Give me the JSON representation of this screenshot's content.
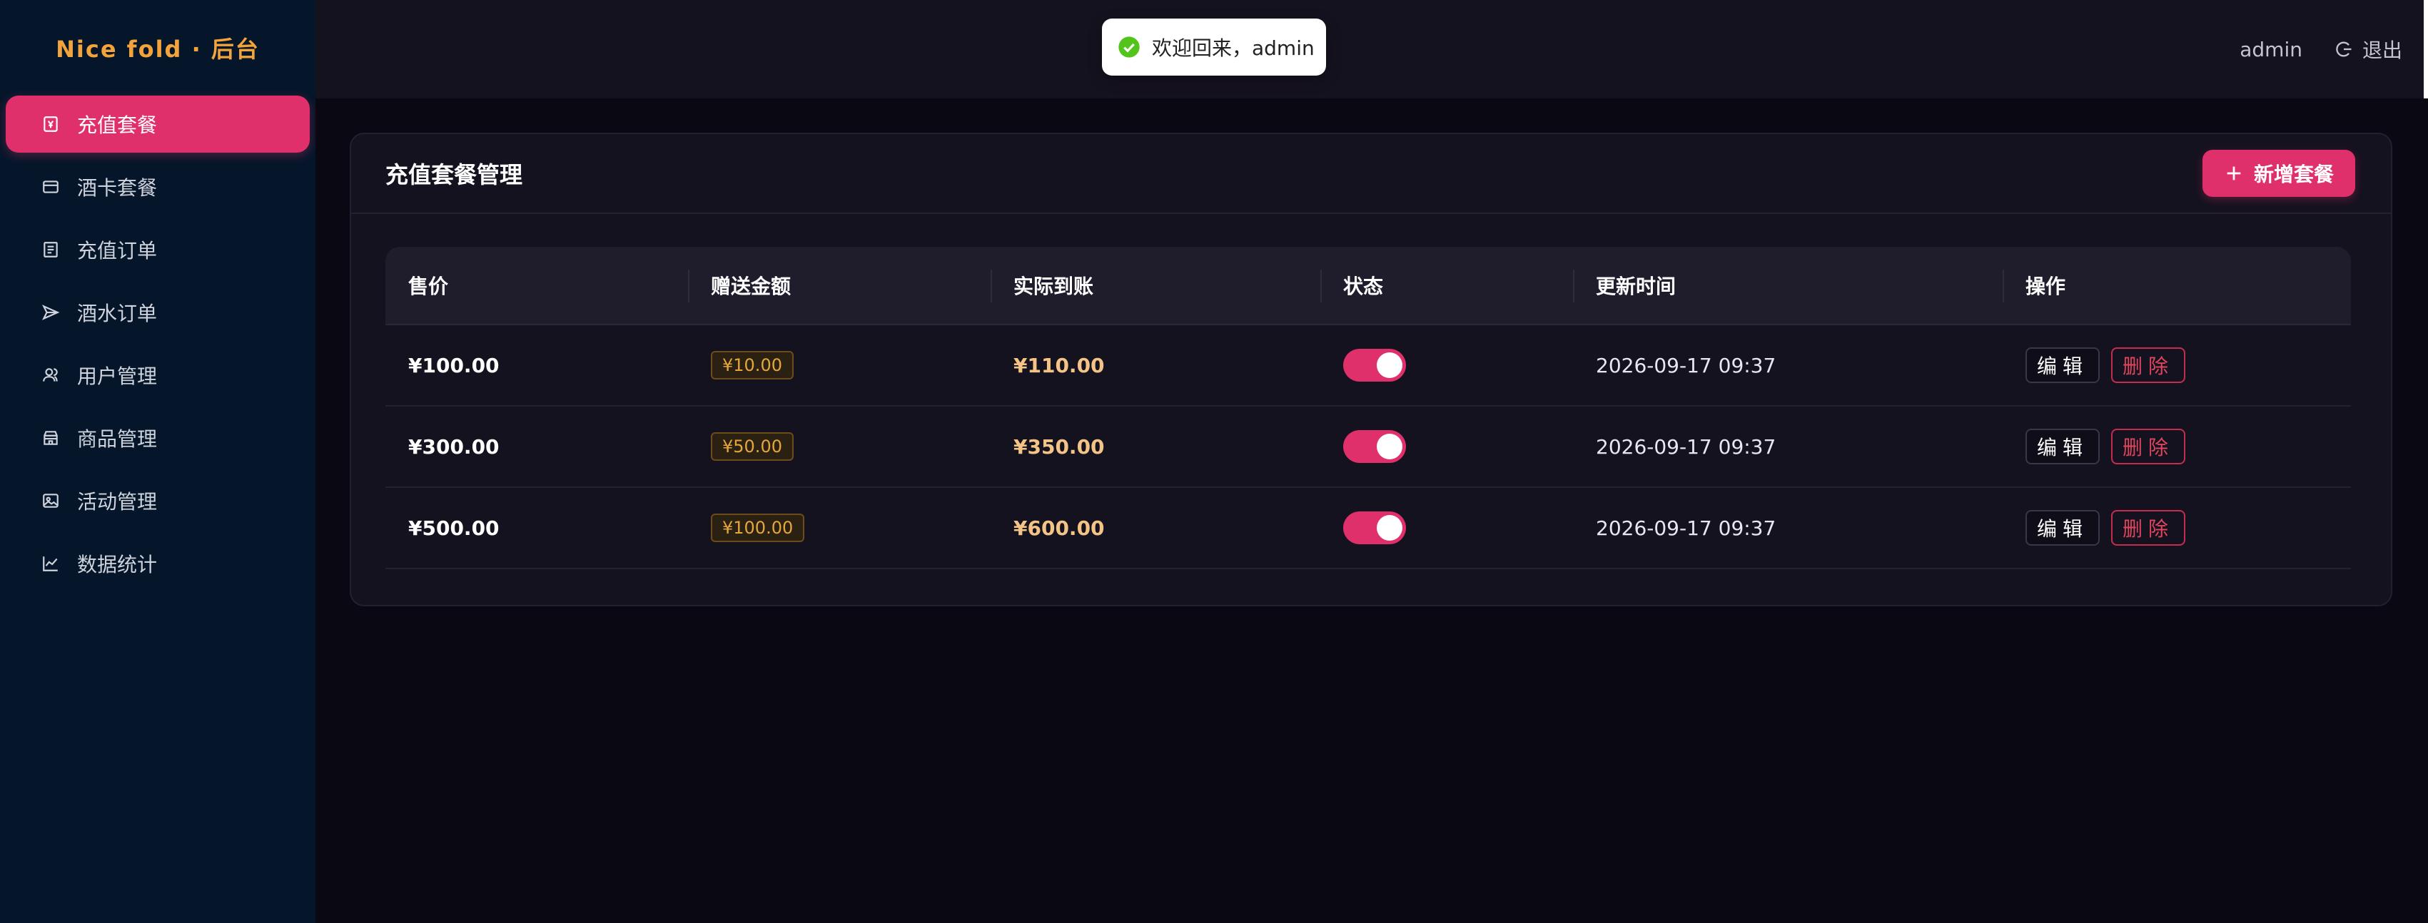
{
  "brand": {
    "title": "Nice fold · 后台"
  },
  "sidebar": {
    "items": [
      {
        "label": "充值套餐",
        "icon": "recharge-icon",
        "active": true
      },
      {
        "label": "酒卡套餐",
        "icon": "card-icon",
        "active": false
      },
      {
        "label": "充值订单",
        "icon": "order-list-icon",
        "active": false
      },
      {
        "label": "酒水订单",
        "icon": "send-icon",
        "active": false
      },
      {
        "label": "用户管理",
        "icon": "users-icon",
        "active": false
      },
      {
        "label": "商品管理",
        "icon": "store-icon",
        "active": false
      },
      {
        "label": "活动管理",
        "icon": "image-icon",
        "active": false
      },
      {
        "label": "数据统计",
        "icon": "chart-icon",
        "active": false
      }
    ]
  },
  "header": {
    "username": "admin",
    "logout_label": "退出"
  },
  "toast": {
    "message": "欢迎回来，admin",
    "status": "success"
  },
  "card": {
    "title": "充值套餐管理",
    "add_button": "新增套餐"
  },
  "table": {
    "columns": [
      "售价",
      "赠送金额",
      "实际到账",
      "状态",
      "更新时间",
      "操作"
    ],
    "rows": [
      {
        "price": "¥100.00",
        "gift": "¥10.00",
        "actual": "¥110.00",
        "enabled": true,
        "updated": "2026-09-17 09:37",
        "edit": "编辑",
        "delete": "删除"
      },
      {
        "price": "¥300.00",
        "gift": "¥50.00",
        "actual": "¥350.00",
        "enabled": true,
        "updated": "2026-09-17 09:37",
        "edit": "编辑",
        "delete": "删除"
      },
      {
        "price": "¥500.00",
        "gift": "¥100.00",
        "actual": "¥600.00",
        "enabled": true,
        "updated": "2026-09-17 09:37",
        "edit": "编辑",
        "delete": "删除"
      }
    ]
  },
  "colors": {
    "accent": "#e0306b",
    "brand": "#f2a33b",
    "sidebar_bg": "#05162a",
    "gold": "#e5a63a"
  }
}
